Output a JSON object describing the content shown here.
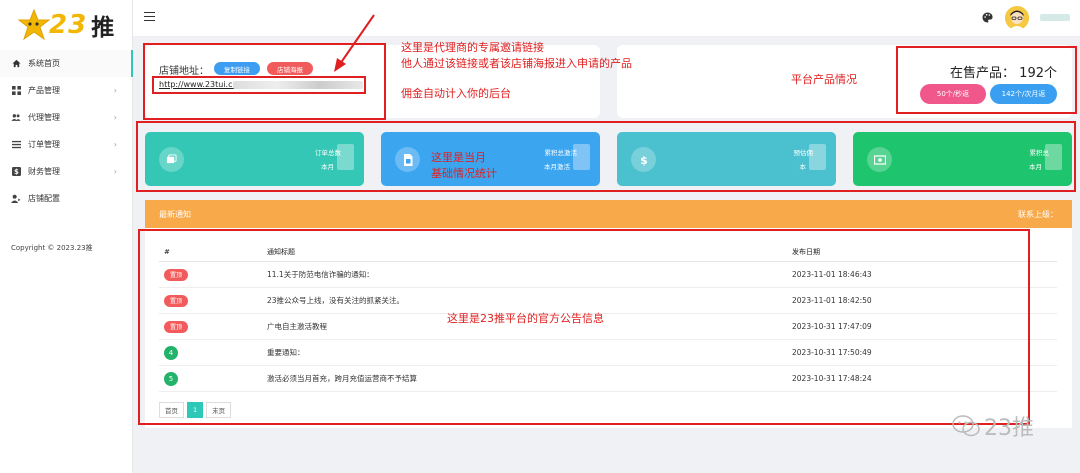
{
  "brand": {
    "logo_text": "23",
    "logo_cn": "推"
  },
  "sidebar": {
    "items": [
      {
        "label": "系统首页",
        "icon": "home-icon",
        "arrow": ""
      },
      {
        "label": "产品管理",
        "icon": "grid-icon",
        "arrow": "›"
      },
      {
        "label": "代理管理",
        "icon": "users-icon",
        "arrow": "›"
      },
      {
        "label": "订单管理",
        "icon": "list-icon",
        "arrow": "›"
      },
      {
        "label": "财务管理",
        "icon": "finance-icon",
        "arrow": "›"
      },
      {
        "label": "店铺配置",
        "icon": "user-config-icon",
        "arrow": ""
      }
    ],
    "copyright": "Copyright © 2023.23推"
  },
  "shop": {
    "label": "店铺地址：",
    "copy_link": "复制链接",
    "poster": "店铺海报",
    "url": "http://www.23tui.cn"
  },
  "products": {
    "on_sale": "在售产品： 192个",
    "pill_a": "50个/秒返",
    "pill_b": "142个/次月返"
  },
  "tiles": [
    {
      "line1": "订单总数",
      "line2": "本月",
      "icon": "wallet-icon",
      "color": "#35c7b5"
    },
    {
      "line1": "累积总激活",
      "line2": "本月激活",
      "icon": "sim-card-icon",
      "color": "#3ba5f0"
    },
    {
      "line1": "预估佣",
      "line2": "本",
      "icon": "dollar-icon",
      "color": "#4bc0cf"
    },
    {
      "line1": "累积总",
      "line2": "本月",
      "icon": "cash-icon",
      "color": "#1fc56e"
    }
  ],
  "notice": {
    "title": "最新通知",
    "contact": "联系上级：",
    "headers": {
      "num": "#",
      "title": "通知标题",
      "date": "发布日期"
    },
    "rows": [
      {
        "badge": "置顶",
        "type": "top",
        "title": "11.1关于防范电信诈骗的通知：",
        "date": "2023-11-01 18:46:43"
      },
      {
        "badge": "置顶",
        "type": "top",
        "title": "23推公众号上线，没有关注的抓紧关注。",
        "date": "2023-11-01 18:42:50"
      },
      {
        "badge": "置顶",
        "type": "top",
        "title": "广电自主激活教程",
        "date": "2023-10-31 17:47:09"
      },
      {
        "badge": "4",
        "type": "num",
        "title": "重要通知：",
        "date": "2023-10-31 17:50:49"
      },
      {
        "badge": "5",
        "type": "num",
        "title": "激活必须当月首充，跨月充值运营商不予结算",
        "date": "2023-10-31 17:48:24"
      }
    ],
    "pager": {
      "first": "首页",
      "current": "1",
      "last": "末页"
    }
  },
  "annotations": {
    "a1_line1": "这里是代理商的专属邀请链接",
    "a1_line2": "他人通过该链接或者该店铺海报进入申请的产品",
    "a1_line3": "佣金自动计入你的后台",
    "a2": "平台产品情况",
    "a3_line1": "这里是当月",
    "a3_line2": "基础情况统计",
    "a4": "这里是23推平台的官方公告信息",
    "color": "#e02020"
  },
  "watermark": "23推"
}
